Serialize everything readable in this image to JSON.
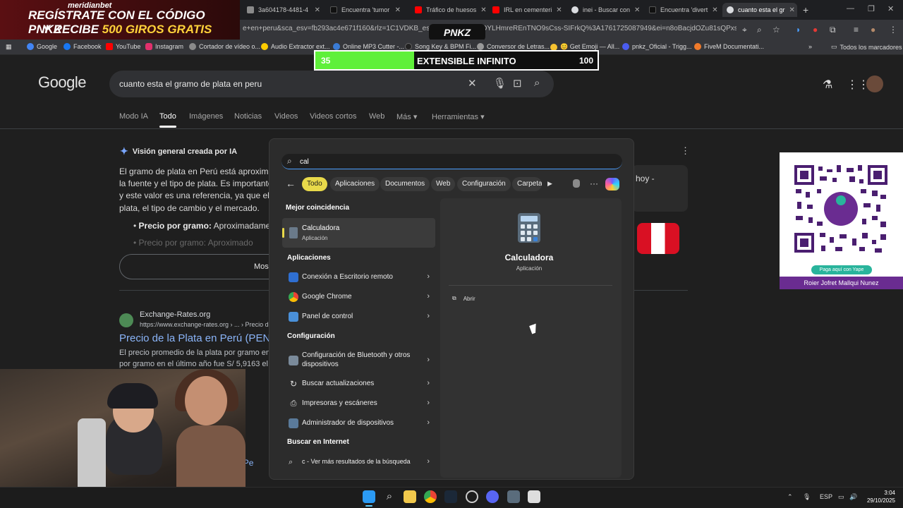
{
  "promo": {
    "brand": "meridianbet",
    "line1": "REGÍSTRATE CON EL CÓDIGO",
    "code": "PNKZ",
    "line2a": "Y RECIBE",
    "line2b": "500 GIROS GRATIS"
  },
  "tabs": [
    {
      "label": "3a604178-4481-4"
    },
    {
      "label": "Encuentra 'tumor"
    },
    {
      "label": "Tráfico de huesos"
    },
    {
      "label": "IRL en cementeri"
    },
    {
      "label": "inei - Buscar con"
    },
    {
      "label": "Encuentra 'divert"
    },
    {
      "label": "cuanto esta el gr"
    }
  ],
  "url": "e+en+peru&sca_esv=fb293ac4e671f160&rlz=1C1VDKB_esPE108... 3TfNeuDYLHmreREnTNO9sCss-SIFrkQ%3A1761725087949&ei=n8oBacjdOZu81sQPxs...",
  "overlay_logo": "PNKZ",
  "bookmarks": [
    {
      "label": "Google",
      "color": "#4285f4"
    },
    {
      "label": "Facebook",
      "color": "#1877f2"
    },
    {
      "label": "YouTube",
      "color": "#ff0000"
    },
    {
      "label": "Instagram",
      "color": "#e1306c"
    },
    {
      "label": "Cortador de vídeo o...",
      "color": "#8a8a8a"
    },
    {
      "label": "Audio Extractor ext...",
      "color": "#ffcc00"
    },
    {
      "label": "Online MP3 Cutter -...",
      "color": "#3a7bd5"
    },
    {
      "label": "Song Key & BPM Fi...",
      "color": "#222222"
    },
    {
      "label": "Conversor de Letras...",
      "color": "#999999"
    },
    {
      "label": "😊 Get Emoji — All...",
      "color": "#f6c230"
    },
    {
      "label": "pnkz_Oficial - Trigg...",
      "color": "#4a5cf0"
    },
    {
      "label": "FiveM Documentati...",
      "color": "#f07a2a"
    }
  ],
  "bookmarks_all": "Todos los marcadores",
  "progress": {
    "current": "35",
    "label": "EXTENSIBLE INFINITO",
    "max": "100",
    "fraction": 0.35
  },
  "google": {
    "logo": "Google",
    "query": "cuanto esta el gramo de plata en peru",
    "tabs": [
      "Modo IA",
      "Todo",
      "Imágenes",
      "Noticias",
      "Videos",
      "Videos cortos",
      "Web",
      "Más ▾",
      "Herramientas ▾"
    ],
    "ai_title": "Visión general creada por IA",
    "ai_lines": [
      "El gramo de plata en Perú está aproxim",
      "la fuente y el tipo de plata. Es importante",
      "y este valor es una referencia, ya que el",
      "plata, el tipo de cambio y el mercado."
    ],
    "bullet1_b": "Precio por gramo:",
    "bullet1": " Aproximadamente",
    "bullet2": "Precio por gramo: Aproximado",
    "show_more": "Mos",
    "side_card": "hoy -",
    "result": {
      "site": "Exchange-Rates.org",
      "url": "https://www.exchange-rates.org › ... › Precio de",
      "title": "Precio de la Plata en Perú (PEN) c",
      "snippet1": "El precio promedio de la plata por gramo en el",
      "snippet2": "por gramo en el último año fue S/ 5,9163 el 16/"
    },
    "partial_link": "a en Pe"
  },
  "qr": {
    "pill": "Paga aquí con Yape",
    "name": "Roier Jofret Mallqui Nunez"
  },
  "start_menu": {
    "query": "cal",
    "chips": [
      "Todo",
      "Aplicaciones",
      "Documentos",
      "Web",
      "Configuración",
      "Carpeta"
    ],
    "best_match_header": "Mejor coincidencia",
    "best_match": {
      "name": "Calculadora",
      "type": "Aplicación"
    },
    "apps_header": "Aplicaciones",
    "apps": [
      {
        "label": "Conexión a Escritorio remoto",
        "color": "#2f6fd1"
      },
      {
        "label": "Google Chrome",
        "color": "#e94235"
      },
      {
        "label": "Panel de control",
        "color": "#4a90d9"
      }
    ],
    "settings_header": "Configuración",
    "settings": [
      {
        "label": "Configuración de Bluetooth y otros dispositivos",
        "icon": "bluetooth-devices-icon"
      },
      {
        "label": "Buscar actualizaciones",
        "icon": "refresh-icon"
      },
      {
        "label": "Impresoras y escáneres",
        "icon": "printer-icon"
      },
      {
        "label": "Administrador de dispositivos",
        "icon": "device-manager-icon"
      }
    ],
    "web_header": "Buscar en Internet",
    "web_item": "c - Ver más resultados de la búsqueda",
    "preview": {
      "name": "Calculadora",
      "type": "Aplicación",
      "open": "Abrir"
    }
  },
  "taskbar": {
    "lang": "ESP",
    "time": "3:04",
    "date": "29/10/2025"
  },
  "colors": {
    "accent_chip": "#e8d94a",
    "progress_fill": "#5ff03a",
    "link": "#8ab4f8",
    "yape_purple": "#6a2c91"
  }
}
